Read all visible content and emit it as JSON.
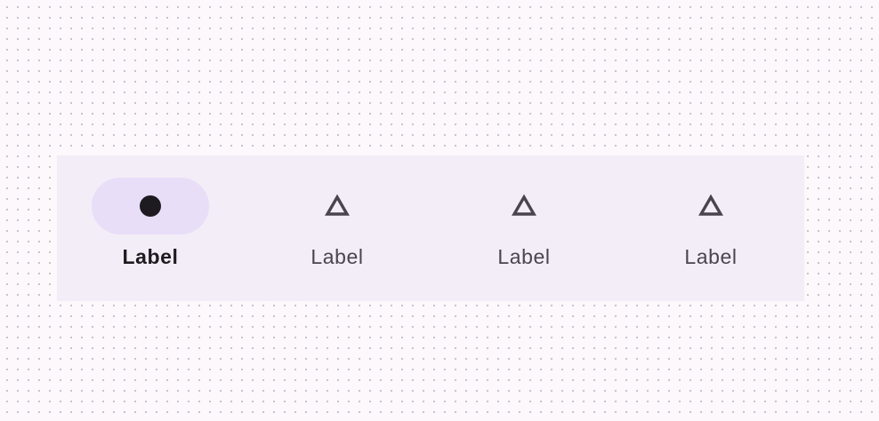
{
  "navigation_bar": {
    "items": [
      {
        "label": "Label",
        "icon": "filled-circle-icon",
        "selected": true
      },
      {
        "label": "Label",
        "icon": "triangle-outline-icon",
        "selected": false
      },
      {
        "label": "Label",
        "icon": "triangle-outline-icon",
        "selected": false
      },
      {
        "label": "Label",
        "icon": "triangle-outline-icon",
        "selected": false
      }
    ],
    "colors": {
      "container": "#f3edf7",
      "active_indicator": "#e8def8",
      "active_icon": "#1d1b20",
      "inactive_icon": "#49454f",
      "canvas_background": "#fdf8fc"
    }
  }
}
